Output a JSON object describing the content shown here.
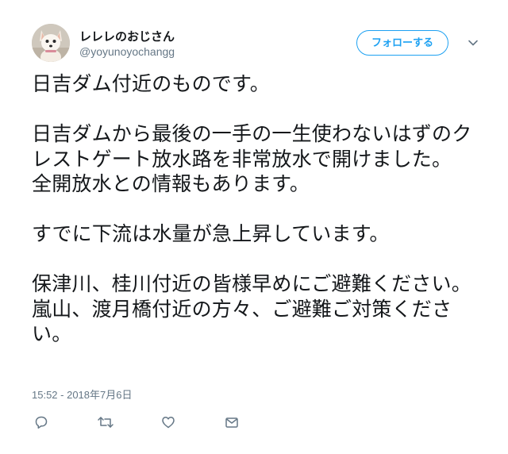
{
  "author": {
    "display_name": "レレレのおじさん",
    "handle": "@yoyunoyochangg"
  },
  "follow_button": {
    "label": "フォローする"
  },
  "tweet": {
    "text": "日吉ダム付近のものです。\n\n日吉ダムから最後の一手の一生使わないはずのクレストゲート放水路を非常放水で開けました。\n全開放水との情報もあります。\n\nすでに下流は水量が急上昇しています。\n\n保津川、桂川付近の皆様早めにご避難ください。嵐山、渡月橋付近の方々、ご避難ご対策ください。",
    "timestamp": "15:52 - 2018年7月6日"
  },
  "icons": {
    "more": "chevron-down-icon",
    "reply": "reply-icon",
    "retweet": "retweet-icon",
    "like": "heart-icon",
    "message": "envelope-icon"
  },
  "colors": {
    "accent": "#1da1f2",
    "secondary_text": "#657786",
    "primary_text": "#14171a",
    "background": "#ffffff"
  }
}
